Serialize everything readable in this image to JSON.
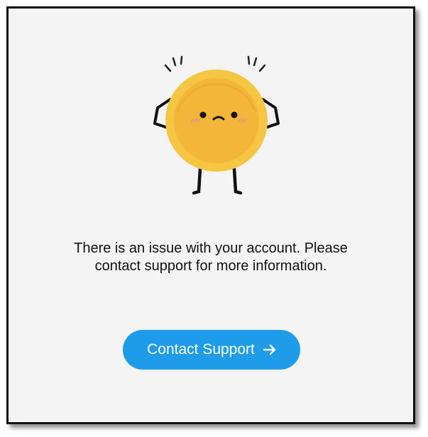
{
  "message": {
    "line1": "There is an issue with your account. Please",
    "line2": "contact support for more information."
  },
  "contact_button": {
    "label": "Contact Support",
    "icon": "arrow-right-icon"
  },
  "illustration": {
    "icon": "sad-coin-mascot-icon",
    "colors": {
      "coin_outer": "#f6c643",
      "coin_inner": "#f3b638",
      "blush": "#f28b8b"
    }
  },
  "colors": {
    "accent": "#1e9be9",
    "background": "#f4f4f4",
    "text": "#111111"
  }
}
